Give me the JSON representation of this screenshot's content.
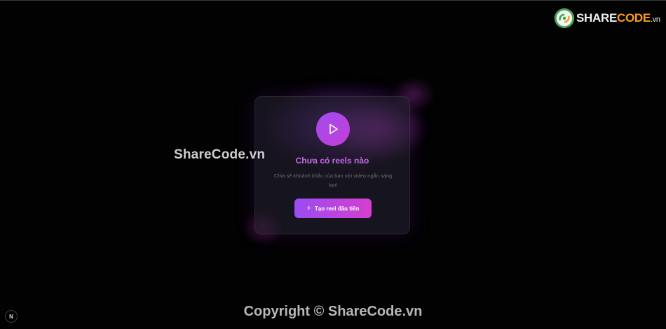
{
  "empty_state": {
    "title": "Chưa có reels nào",
    "description": "Chia sẻ khoảnh khắc của bạn với video ngắn sáng tạo!",
    "create_button_label": "Tạo reel đầu tiên",
    "create_button_icon": "plus-icon",
    "hero_icon": "play-icon"
  },
  "watermarks": {
    "center": "ShareCode.vn",
    "copyright": "Copyright © ShareCode.vn"
  },
  "logo": {
    "share": "SHARE",
    "code": "CODE",
    "suffix": ".vn"
  },
  "dev_badge": {
    "label": "N"
  },
  "colors": {
    "background": "#020203",
    "accent_purple": "#9a4cf2",
    "accent_pink": "#d43fd0",
    "title_color": "#c56ae8",
    "logo_orange": "#ff9a1e"
  }
}
